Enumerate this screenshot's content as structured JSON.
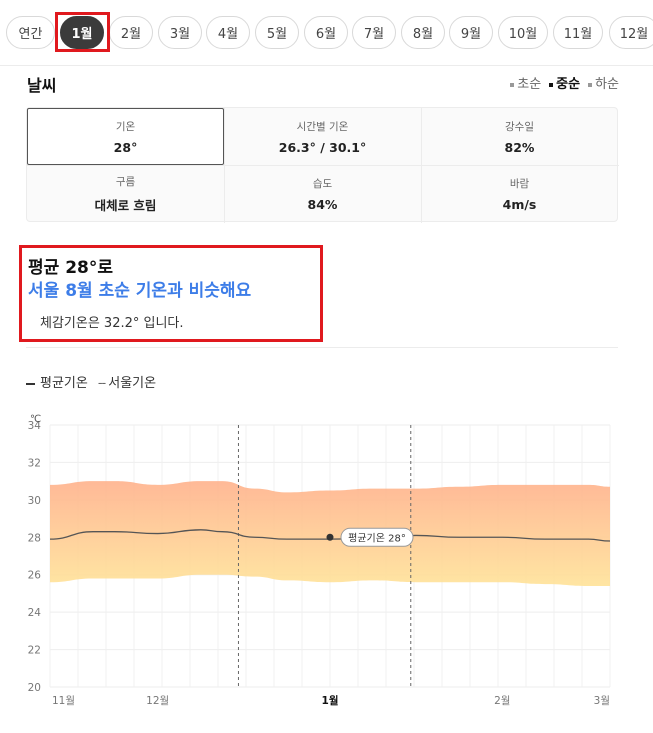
{
  "tabs": [
    {
      "label": "연간",
      "active": false
    },
    {
      "label": "1월",
      "active": true
    },
    {
      "label": "2월",
      "active": false
    },
    {
      "label": "3월",
      "active": false
    },
    {
      "label": "4월",
      "active": false
    },
    {
      "label": "5월",
      "active": false
    },
    {
      "label": "6월",
      "active": false
    },
    {
      "label": "7월",
      "active": false
    },
    {
      "label": "8월",
      "active": false
    },
    {
      "label": "9월",
      "active": false
    },
    {
      "label": "10월",
      "active": false
    },
    {
      "label": "11월",
      "active": false
    },
    {
      "label": "12월",
      "active": false
    }
  ],
  "weather": {
    "title": "날씨",
    "filters": [
      {
        "label": "초순",
        "selected": false
      },
      {
        "label": "중순",
        "selected": true
      },
      {
        "label": "하순",
        "selected": false
      }
    ],
    "stats": [
      {
        "label": "기온",
        "value": "28°",
        "selected": true
      },
      {
        "label": "시간별 기온",
        "value": "26.3° / 30.1°",
        "selected": false
      },
      {
        "label": "강수일",
        "value": "82%",
        "selected": false
      },
      {
        "label": "구름",
        "value": "대체로 흐림",
        "selected": false
      },
      {
        "label": "습도",
        "value": "84%",
        "selected": false
      },
      {
        "label": "바람",
        "value": "4m/s",
        "selected": false
      }
    ]
  },
  "summary": {
    "average": "평균 28°로",
    "comparison": "서울 8월 초순 기온과 비슷해요",
    "feels_like": "체감기온은 32.2° 입니다."
  },
  "legend": {
    "avg_label": "평균기온",
    "seoul_label": "서울기온"
  },
  "colors": {
    "highlight": "#e0191e",
    "accent_blue": "#3d7de8",
    "band_top": "#ffb38e",
    "band_bottom": "#ffe39a"
  },
  "chart_data": {
    "type": "area",
    "unit": "℃",
    "ylim": [
      20,
      34
    ],
    "yticks": [
      20,
      22,
      24,
      26,
      28,
      30,
      32,
      34
    ],
    "x_tick_labels": [
      "11월",
      "12월",
      "1월",
      "2월",
      "3월"
    ],
    "x_tick_positions": [
      0,
      1.0,
      2.6,
      4.2,
      5.2
    ],
    "highlight_range": [
      1.75,
      3.35
    ],
    "x": [
      0,
      0.4,
      0.6,
      1.0,
      1.4,
      1.6,
      1.9,
      2.2,
      2.6,
      3.0,
      3.4,
      3.8,
      4.2,
      4.6,
      5.0,
      5.2
    ],
    "series": [
      {
        "name": "평균기온",
        "values": [
          27.9,
          28.3,
          28.3,
          28.2,
          28.4,
          28.3,
          28.0,
          27.9,
          27.9,
          28.0,
          28.1,
          28.0,
          28.0,
          27.9,
          27.9,
          27.8
        ]
      },
      {
        "name": "upper",
        "values": [
          30.8,
          31.0,
          31.0,
          30.8,
          31.0,
          31.0,
          30.6,
          30.4,
          30.5,
          30.6,
          30.6,
          30.7,
          30.8,
          30.8,
          30.8,
          30.7
        ]
      },
      {
        "name": "lower",
        "values": [
          25.6,
          25.8,
          25.8,
          25.8,
          26.0,
          26.0,
          25.9,
          25.7,
          25.6,
          25.7,
          25.6,
          25.6,
          25.6,
          25.5,
          25.4,
          25.4
        ]
      }
    ],
    "marker": {
      "x": 2.6,
      "value": 28,
      "label": "평균기온 28°"
    }
  }
}
